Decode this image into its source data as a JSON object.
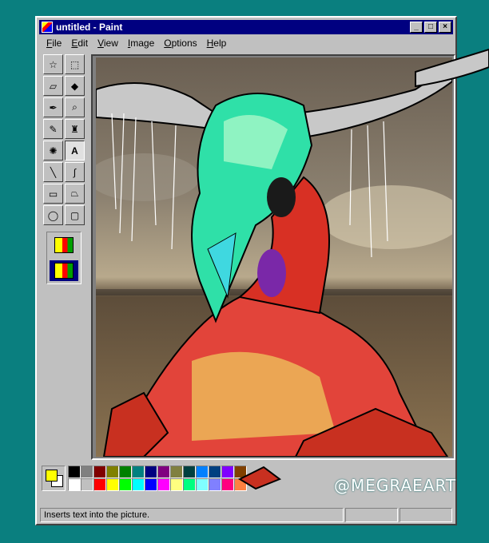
{
  "window": {
    "title": "untitled - Paint"
  },
  "title_buttons": {
    "minimize": "_",
    "maximize": "□",
    "close": "×"
  },
  "menu": [
    "File",
    "Edit",
    "View",
    "Image",
    "Options",
    "Help"
  ],
  "tools": [
    {
      "name": "free-form-select-icon",
      "glyph": "☆"
    },
    {
      "name": "select-icon",
      "glyph": "⬚"
    },
    {
      "name": "eraser-icon",
      "glyph": "▱"
    },
    {
      "name": "fill-icon",
      "glyph": "◆"
    },
    {
      "name": "pick-color-icon",
      "glyph": "✒"
    },
    {
      "name": "magnifier-icon",
      "glyph": "⌕"
    },
    {
      "name": "pencil-icon",
      "glyph": "✎"
    },
    {
      "name": "brush-icon",
      "glyph": "♜"
    },
    {
      "name": "airbrush-icon",
      "glyph": "✺"
    },
    {
      "name": "text-icon",
      "glyph": "A"
    },
    {
      "name": "line-icon",
      "glyph": "╲"
    },
    {
      "name": "curve-icon",
      "glyph": "∫"
    },
    {
      "name": "rectangle-icon",
      "glyph": "▭"
    },
    {
      "name": "polygon-icon",
      "glyph": "⏢"
    },
    {
      "name": "ellipse-icon",
      "glyph": "◯"
    },
    {
      "name": "rounded-rectangle-icon",
      "glyph": "▢"
    }
  ],
  "active_tool": "text-icon",
  "colors": {
    "foreground": "#ffff00",
    "background": "#ffffff",
    "palette": [
      "#000000",
      "#808080",
      "#800000",
      "#808000",
      "#008000",
      "#008080",
      "#000080",
      "#800080",
      "#808040",
      "#004040",
      "#0080ff",
      "#004080",
      "#8000ff",
      "#804000",
      "#ffffff",
      "#c0c0c0",
      "#ff0000",
      "#ffff00",
      "#00ff00",
      "#00ffff",
      "#0000ff",
      "#ff00ff",
      "#ffff80",
      "#00ff80",
      "#80ffff",
      "#8080ff",
      "#ff0080",
      "#ff8040"
    ]
  },
  "status": {
    "text": "Inserts text into the picture."
  },
  "watermark": "@MEGRAEART"
}
